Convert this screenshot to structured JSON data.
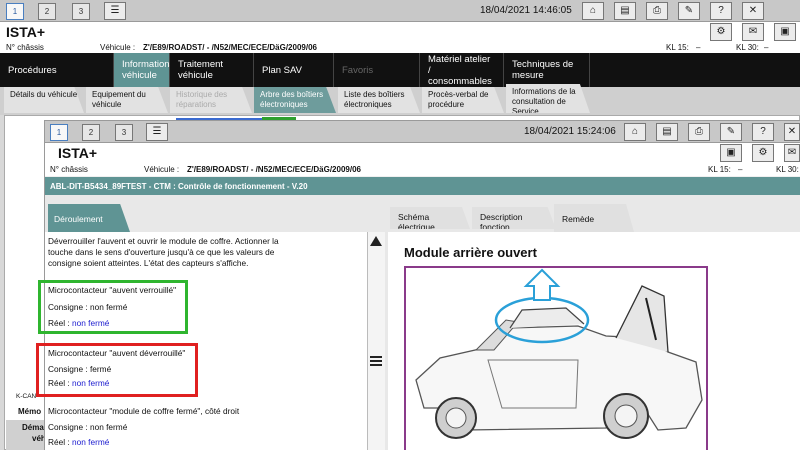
{
  "outer": {
    "toolbar": {
      "nums": [
        "1",
        "2",
        "3"
      ],
      "datetime": "18/04/2021 14:46:05"
    },
    "app_title": "ISTA+",
    "info": {
      "chassis_label": "N° châssis",
      "vehicle_label": "Véhicule :",
      "vehicle_value": "Z'/E89/ROADST/ - /N52/MEC/ECE/DäG/2009/06",
      "kl15_label": "KL 15:",
      "kl15_value": "–",
      "kl30_label": "KL 30:",
      "kl30_value": "–"
    },
    "nav_tabs": [
      "Procédures",
      "Informations véhicule",
      "Traitement véhicule",
      "Plan SAV",
      "Favoris",
      "Matériel atelier / consommables",
      "Techniques de mesure"
    ],
    "sub_tabs": [
      "Détails du véhicule",
      "Equipement du véhicule",
      "Historique des réparations",
      "Arbre des boîtiers électroniques",
      "Liste des boîtiers électroniques",
      "Procès-verbal de procédure",
      "Informations de la consultation de Service"
    ],
    "left_stub": {
      "kcan": "K-CAN",
      "memo": "Mémo",
      "dema": "Déma",
      "vehi": "véhi"
    }
  },
  "inner": {
    "toolbar": {
      "nums": [
        "1",
        "2",
        "3"
      ],
      "datetime": "18/04/2021 15:24:06"
    },
    "app_title": "ISTA+",
    "info": {
      "chassis_label": "N° châssis",
      "vehicle_label": "Véhicule :",
      "vehicle_value": "Z'/E89/ROADST/ - /N52/MEC/ECE/DäG/2009/06",
      "kl15_label": "KL 15:",
      "kl15_value": "–",
      "kl30_label": "KL 30:",
      "kl30_value": "–"
    },
    "test_title": "ABL-DIT-B5434_89FTEST - CTM : Contrôle de fonctionnement - V.20",
    "left_tab": "Déroulement",
    "right_tabs": [
      "Schéma électrique",
      "Description fonction",
      "Remède"
    ],
    "instruction": "Déverrouiller l'auvent et ouvrir le module de coffre. Actionner la touche dans le sens d'ouverture jusqu'à ce que les valeurs de consigne soient atteintes. L'état des capteurs s'affiche.",
    "checks": [
      {
        "name": "Microcontacteur \"auvent verrouillé\"",
        "consigne": "Consigne : non fermé",
        "reel_label": "Réel :",
        "reel_value": "non fermé"
      },
      {
        "name": "Microcontacteur \"auvent déverrouillé\"",
        "consigne": "Consigne : fermé",
        "reel_label": "Réel :",
        "reel_value": "non fermé"
      },
      {
        "name": "Microcontacteur \"module de coffre fermé\", côté droit",
        "consigne": "Consigne : non fermé",
        "reel_label": "Réel :",
        "reel_value": "non fermé"
      }
    ],
    "image_title": "Module arrière ouvert"
  },
  "colors": {
    "teal": "#5f9494",
    "green_box": "#2fb52f",
    "red_box": "#e02020",
    "arrow": "#2aa0d8",
    "frame": "#8a3a8a"
  }
}
